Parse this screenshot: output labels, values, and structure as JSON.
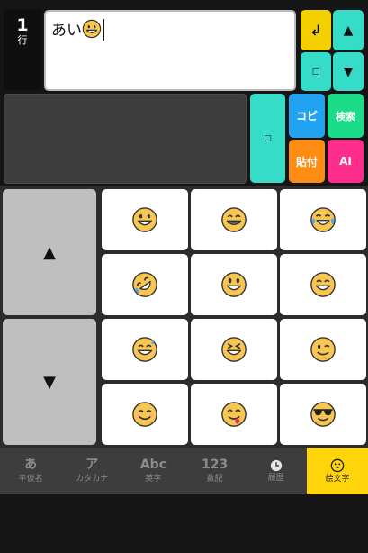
{
  "status": {
    "line_number": "1",
    "line_label": "行"
  },
  "editor": {
    "text": "あい",
    "emoji_after_text": "grinning-face"
  },
  "controls": {
    "enter_glyph": "↲",
    "up_glyph": "▲",
    "down_glyph": "▼",
    "box_glyph": "□",
    "copy_label": "コピ",
    "search_label": "検索",
    "paste_label": "貼付",
    "ai_label": "AI"
  },
  "keyboard": {
    "page_up_glyph": "▲",
    "page_down_glyph": "▼",
    "emoji_keys": [
      "grinning-face",
      "beaming-face-with-smiling-eyes",
      "face-with-tears-of-joy",
      "rolling-on-the-floor-laughing",
      "grinning-face-with-big-eyes",
      "grinning-face-with-smiling-eyes",
      "grinning-face-with-sweat",
      "grinning-squinting-face",
      "winking-face",
      "smiling-face-with-smiling-eyes",
      "face-savoring-food",
      "smiling-face-with-sunglasses"
    ]
  },
  "nav": {
    "tabs": [
      {
        "big": "あ",
        "small": "平仮名"
      },
      {
        "big": "ア",
        "small": "カタカナ"
      },
      {
        "big": "Abc",
        "small": "英字"
      },
      {
        "big": "123",
        "small": "数記"
      },
      {
        "icon": "clock-icon",
        "small": "履歴"
      },
      {
        "icon": "emoji-icon",
        "small": "絵文字"
      }
    ],
    "active_index": 5
  },
  "colors": {
    "accent_yellow": "#f4cf00",
    "teal": "#35ddc9",
    "copy_blue": "#21a3f1",
    "search_green": "#1bdc88",
    "paste_orange": "#ff8c12",
    "ai_pink": "#ff2d8b"
  }
}
